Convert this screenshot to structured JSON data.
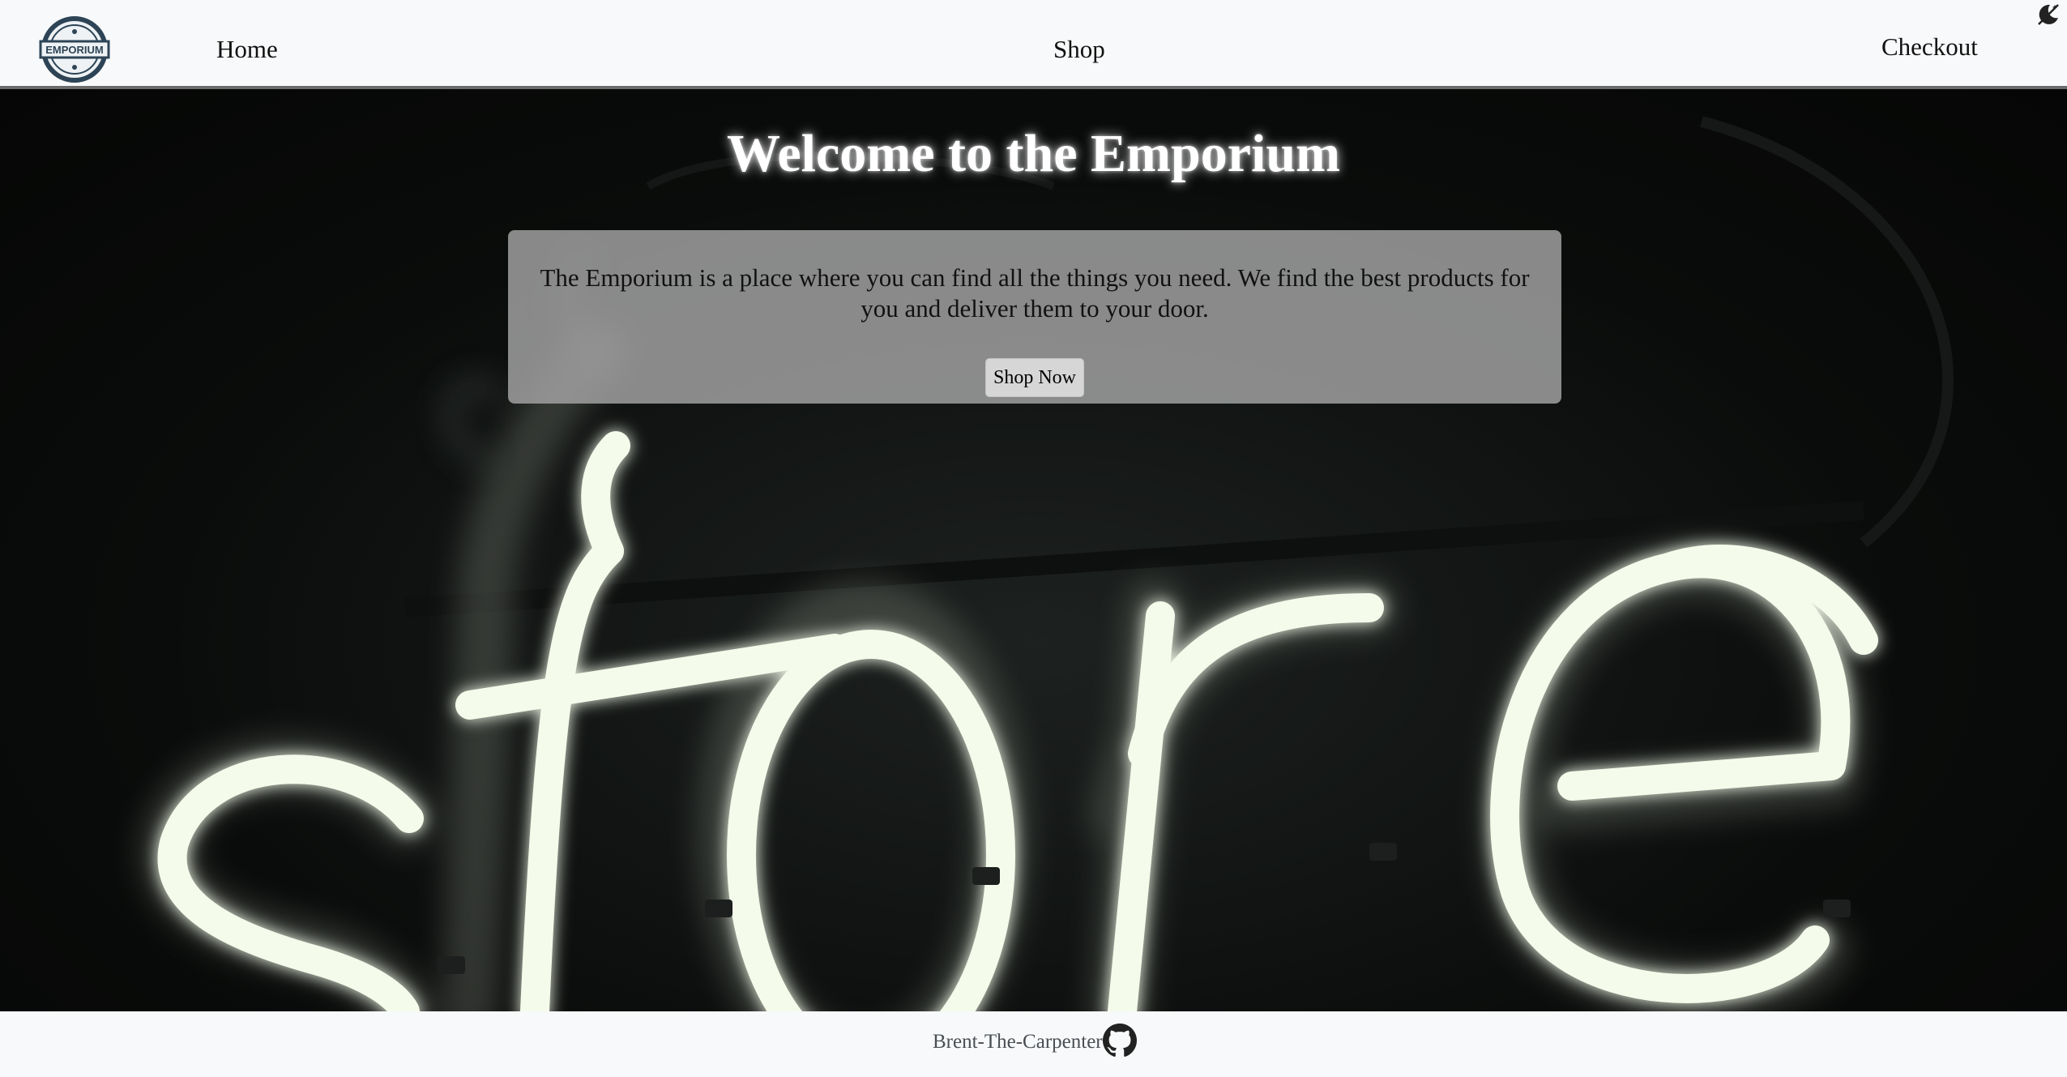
{
  "navbar": {
    "logo_text": "EMPORIUM",
    "links": {
      "home": "Home",
      "shop": "Shop",
      "checkout": "Checkout"
    },
    "theme_toggle_icon": "moon-stars-icon"
  },
  "hero": {
    "background_icon": "neon-store-sign",
    "sign_text": "store",
    "title": "Welcome to the Emporium",
    "intro": "The Emporium is a place where you can find all the things you need. We find the best products for you and deliver them to your door.",
    "cta_label": "Shop Now"
  },
  "footer": {
    "author": "Brent-The-Carpenter",
    "icon": "github-icon"
  },
  "colors": {
    "navbar_bg": "#f8f9fa",
    "hero_bg": "#0a0c0b",
    "neon": "#f4fbea",
    "card_bg": "#a0a0a0"
  }
}
